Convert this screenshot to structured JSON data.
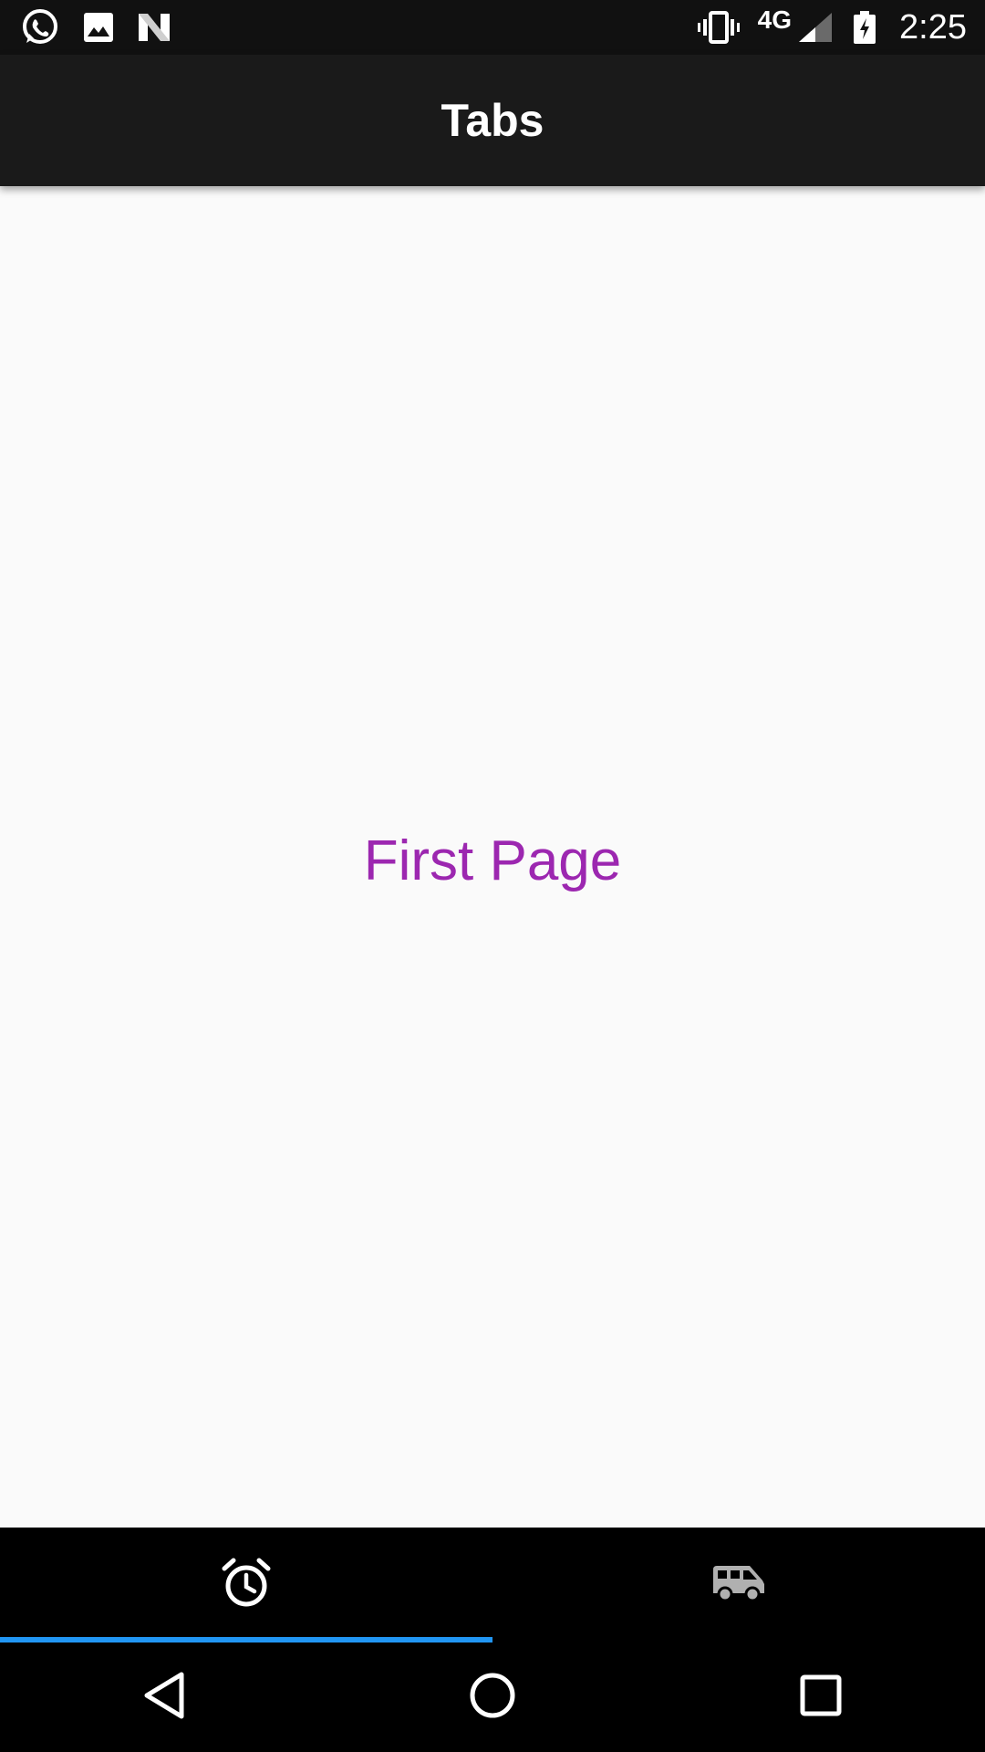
{
  "status_bar": {
    "left_icons": [
      "whatsapp-icon",
      "image-icon",
      "n-logo-icon"
    ],
    "right_icons": [
      "vibrate-icon",
      "signal-icon",
      "battery-charging-icon"
    ],
    "network_label": "4G",
    "time": "2:25"
  },
  "app_bar": {
    "title": "Tabs"
  },
  "content": {
    "page_text": "First Page"
  },
  "tabs": [
    {
      "icon": "alarm-icon",
      "selected": true
    },
    {
      "icon": "van-icon",
      "selected": false
    }
  ],
  "nav_bar": {
    "buttons": [
      "back-icon",
      "home-icon",
      "recents-icon"
    ]
  },
  "colors": {
    "page_text": "#9c27b0",
    "tab_indicator": "#2196f3",
    "tab_selected_icon": "#ffffff",
    "tab_unselected_icon": "#b0b0b0",
    "app_bar": "#1a1a1a",
    "status_bar": "#111111"
  }
}
